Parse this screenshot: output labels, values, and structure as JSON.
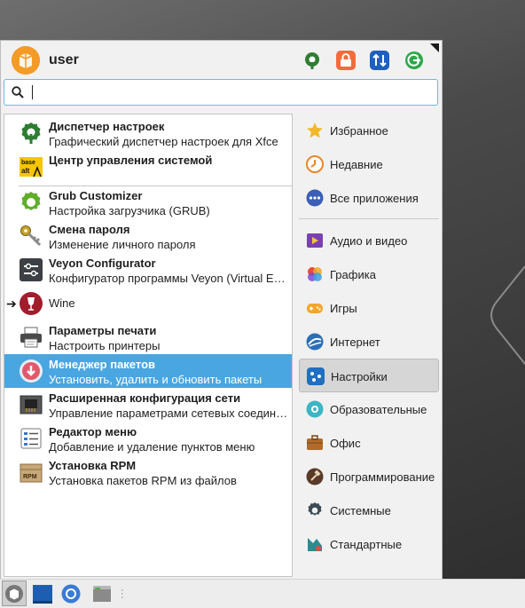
{
  "user": {
    "name": "user"
  },
  "search": {
    "value": "",
    "placeholder": ""
  },
  "header_buttons": [
    {
      "icon": "settings-manager-icon",
      "color": "#2e7d32"
    },
    {
      "icon": "lock-screen-icon",
      "color": "#f26c3d"
    },
    {
      "icon": "switch-user-icon",
      "color": "#1e5fbf"
    },
    {
      "icon": "logout-icon",
      "color": "#2ea84a"
    }
  ],
  "favorites": [
    {
      "name": "Диспетчер настроек",
      "desc": "Графический диспетчер настроек для Xfce"
    },
    {
      "name": "Центр управления системой",
      "desc": ""
    }
  ],
  "apps": [
    {
      "name": "Grub Customizer",
      "desc": "Настройка загрузчика (GRUB)"
    },
    {
      "name": "Смена пароля",
      "desc": "Изменение личного пароля"
    },
    {
      "name": "Veyon Configurator",
      "desc": "Конфигуратор программы Veyon (Virtual E…"
    },
    {
      "name": "Wine",
      "desc": ""
    },
    {
      "name": "Параметры печати",
      "desc": "Настроить принтеры"
    },
    {
      "name": "Менеджер пакетов",
      "desc": "Установить, удалить и обновить пакеты",
      "selected": true
    },
    {
      "name": "Расширенная конфигурация сети",
      "desc": "Управление параметрами сетевых соедин…"
    },
    {
      "name": "Редактор меню",
      "desc": "Добавление и удаление пунктов меню"
    },
    {
      "name": "Установка RPM",
      "desc": "Установка пакетов RPM из файлов"
    }
  ],
  "categories_top": [
    {
      "label": "Избранное",
      "icon": "star-icon"
    },
    {
      "label": "Недавние",
      "icon": "clock-icon"
    },
    {
      "label": "Все приложения",
      "icon": "all-apps-icon"
    }
  ],
  "categories": [
    {
      "label": "Аудио и видео",
      "icon": "multimedia-icon"
    },
    {
      "label": "Графика",
      "icon": "graphics-icon"
    },
    {
      "label": "Игры",
      "icon": "gamepad-icon"
    },
    {
      "label": "Интернет",
      "icon": "internet-icon"
    },
    {
      "label": "Настройки",
      "icon": "settings-icon",
      "active": true
    },
    {
      "label": "Образовательные",
      "icon": "education-icon"
    },
    {
      "label": "Офис",
      "icon": "briefcase-icon"
    },
    {
      "label": "Программирование",
      "icon": "hammer-icon"
    },
    {
      "label": "Системные",
      "icon": "gear-icon"
    },
    {
      "label": "Стандартные",
      "icon": "accessories-icon"
    }
  ],
  "accent_color": "#4aa6e0"
}
